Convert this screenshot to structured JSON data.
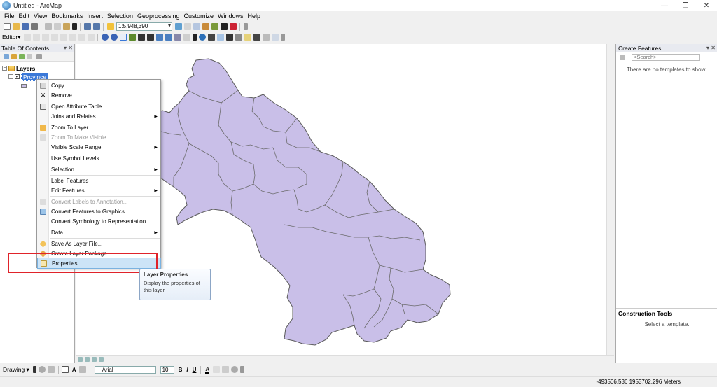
{
  "window": {
    "title": "Untitled - ArcMap",
    "controls": [
      "—",
      "❐",
      "✕"
    ]
  },
  "menu": [
    "File",
    "Edit",
    "View",
    "Bookmarks",
    "Insert",
    "Selection",
    "Geoprocessing",
    "Customize",
    "Windows",
    "Help"
  ],
  "toolbar": {
    "scale_value": "1:5,948,390",
    "editor_label": "Editor▾"
  },
  "toc": {
    "title": "Table Of Contents",
    "pin": "▾ ✕",
    "root_label": "Layers",
    "layer_label": "Province"
  },
  "context_menu": {
    "items": [
      {
        "label": "Copy",
        "icon": "copy-icon",
        "enabled": true,
        "submenu": false
      },
      {
        "label": "Remove",
        "icon": "remove-icon",
        "enabled": true,
        "submenu": false
      },
      {
        "label": "Open Attribute Table",
        "icon": "table-icon",
        "enabled": true,
        "submenu": false
      },
      {
        "label": "Joins and Relates",
        "icon": "",
        "enabled": true,
        "submenu": true
      },
      {
        "label": "Zoom To Layer",
        "icon": "zoom-layer-icon",
        "enabled": true,
        "submenu": false
      },
      {
        "label": "Zoom To Make Visible",
        "icon": "zoom-visible-icon",
        "enabled": false,
        "submenu": false
      },
      {
        "label": "Visible Scale Range",
        "icon": "",
        "enabled": true,
        "submenu": true
      },
      {
        "label": "Use Symbol Levels",
        "icon": "",
        "enabled": true,
        "submenu": false
      },
      {
        "label": "Selection",
        "icon": "",
        "enabled": true,
        "submenu": true
      },
      {
        "label": "Label Features",
        "icon": "",
        "enabled": true,
        "submenu": false
      },
      {
        "label": "Edit Features",
        "icon": "",
        "enabled": true,
        "submenu": true
      },
      {
        "label": "Convert Labels to Annotation...",
        "icon": "annotation-icon",
        "enabled": false,
        "submenu": false
      },
      {
        "label": "Convert Features to Graphics...",
        "icon": "graphics-icon",
        "enabled": true,
        "submenu": false
      },
      {
        "label": "Convert Symbology to Representation...",
        "icon": "",
        "enabled": true,
        "submenu": false
      },
      {
        "label": "Data",
        "icon": "",
        "enabled": true,
        "submenu": true
      },
      {
        "label": "Save As Layer File...",
        "icon": "layer-file-icon",
        "enabled": true,
        "submenu": false
      },
      {
        "label": "Create Layer Package...",
        "icon": "layer-package-icon",
        "enabled": true,
        "submenu": false
      },
      {
        "label": "Properties...",
        "icon": "properties-icon",
        "enabled": true,
        "submenu": false,
        "highlighted": true
      }
    ]
  },
  "tooltip": {
    "title": "Layer Properties",
    "body": "Display the properties of this layer"
  },
  "create_features": {
    "title": "Create Features",
    "search_placeholder": "<Search>",
    "empty_message": "There are no templates to show."
  },
  "construction_tools": {
    "title": "Construction Tools",
    "message": "Select a template."
  },
  "drawing": {
    "label": "Drawing ▾",
    "font": "Arial",
    "size": "10",
    "bold": "B",
    "italic": "I",
    "underline": "U"
  },
  "status": {
    "coordinates": "-493506.536  1953702.296 Meters"
  },
  "colors": {
    "polygon_fill": "#c9bfe8",
    "polygon_stroke": "#5a5a5a",
    "highlight": "#cce4f7",
    "annotation_red": "#e0232a"
  }
}
